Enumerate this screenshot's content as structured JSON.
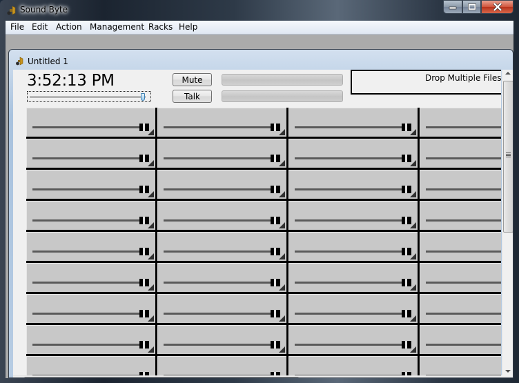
{
  "window": {
    "title": "Sound Byte",
    "icon": "gramophone-icon",
    "controls": [
      "minimize",
      "maximize",
      "close"
    ]
  },
  "menubar": {
    "items": [
      {
        "label": "File"
      },
      {
        "label": "Edit"
      },
      {
        "label": "Action"
      },
      {
        "label": "Management"
      },
      {
        "label": "Racks"
      },
      {
        "label": "Help"
      }
    ]
  },
  "document": {
    "title": "Untitled 1",
    "icon": "gramophone-icon",
    "clock": "3:52:13 PM",
    "master_volume_fraction": 1.0,
    "mute_label": "Mute",
    "talk_label": "Talk",
    "meters": [
      {
        "name": "level-meter-1",
        "level": 0
      },
      {
        "name": "level-meter-2",
        "level": 0
      }
    ],
    "drop_zone_text": "Drop Multiple Files H",
    "grid": {
      "visible_rows": 9,
      "visible_columns": 4,
      "cell_volume_fraction": 1.0
    },
    "colors": {
      "cell_bg": "#c8c8c8",
      "cell_border": "#000000",
      "track": "#5a5a5a",
      "client_bg": "#f0f0f0"
    }
  }
}
